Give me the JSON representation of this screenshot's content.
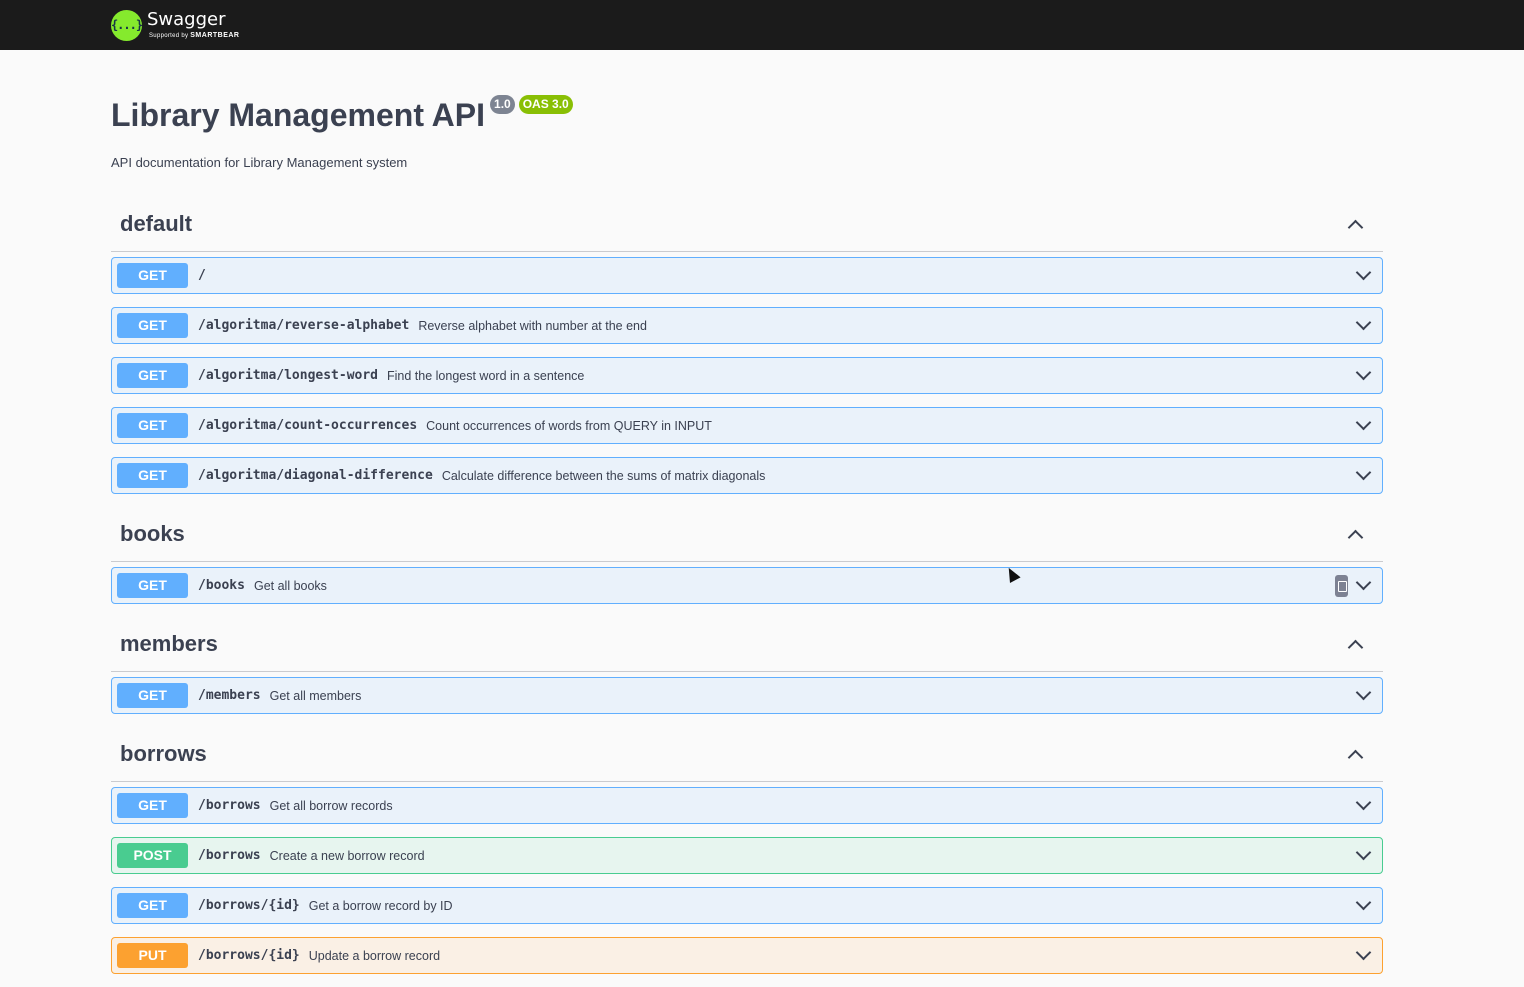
{
  "topbar": {
    "logo_glyph": "{...}",
    "brand": "Swagger",
    "supported_by": "Supported by",
    "smartbear": "SMARTBEAR"
  },
  "info": {
    "title": "Library Management API",
    "version": "1.0",
    "oas": "OAS 3.0",
    "description": "API documentation for Library Management system"
  },
  "colors": {
    "get": "#61affe",
    "post": "#49cc90",
    "put": "#fca130",
    "topbar": "#1b1b1b",
    "logo": "#85ea2d"
  },
  "tags": [
    {
      "name": "default",
      "ops": [
        {
          "method": "GET",
          "path": "/",
          "summary": ""
        },
        {
          "method": "GET",
          "path": "/algoritma/reverse-alphabet",
          "summary": "Reverse alphabet with number at the end"
        },
        {
          "method": "GET",
          "path": "/algoritma/longest-word",
          "summary": "Find the longest word in a sentence"
        },
        {
          "method": "GET",
          "path": "/algoritma/count-occurrences",
          "summary": "Count occurrences of words from QUERY in INPUT"
        },
        {
          "method": "GET",
          "path": "/algoritma/diagonal-difference",
          "summary": "Calculate difference between the sums of matrix diagonals"
        }
      ]
    },
    {
      "name": "books",
      "ops": [
        {
          "method": "GET",
          "path": "/books",
          "summary": "Get all books"
        }
      ]
    },
    {
      "name": "members",
      "ops": [
        {
          "method": "GET",
          "path": "/members",
          "summary": "Get all members"
        }
      ]
    },
    {
      "name": "borrows",
      "ops": [
        {
          "method": "GET",
          "path": "/borrows",
          "summary": "Get all borrow records"
        },
        {
          "method": "POST",
          "path": "/borrows",
          "summary": "Create a new borrow record"
        },
        {
          "method": "GET",
          "path": "/borrows/{id}",
          "summary": "Get a borrow record by ID"
        },
        {
          "method": "PUT",
          "path": "/borrows/{id}",
          "summary": "Update a borrow record"
        }
      ]
    }
  ]
}
